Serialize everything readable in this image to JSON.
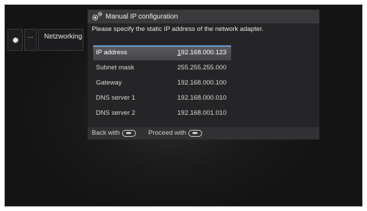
{
  "sidebar": {
    "dots_label": "...",
    "networking_label": "Netzworking"
  },
  "dialog": {
    "title": "Manual IP configuration",
    "instruction": "Please specify the static IP address of the network adapter.",
    "fields": [
      {
        "label": "IP address",
        "value_cursor": "1",
        "value_rest": "92.168.000.123"
      },
      {
        "label": "Subnet mask",
        "value": "255.255.255.000"
      },
      {
        "label": "Gateway",
        "value": "192.168.000.100"
      },
      {
        "label": "DNS server 1",
        "value": "192.168.000.010"
      },
      {
        "label": "DNS server 2",
        "value": "192.168.001.010"
      }
    ],
    "footer": {
      "back": "Back with",
      "proceed": "Proceed with"
    }
  },
  "icons": {
    "settings": "gear-icon",
    "dialog_title": "gears-icon",
    "remote_back": "remote-back-button-icon",
    "remote_forward": "remote-forward-button-icon"
  },
  "colors": {
    "background": "#1a1a1b",
    "dialog": "#252527",
    "title_bar": "#3a3a3c",
    "selection_accent": "#6aa0d8"
  }
}
